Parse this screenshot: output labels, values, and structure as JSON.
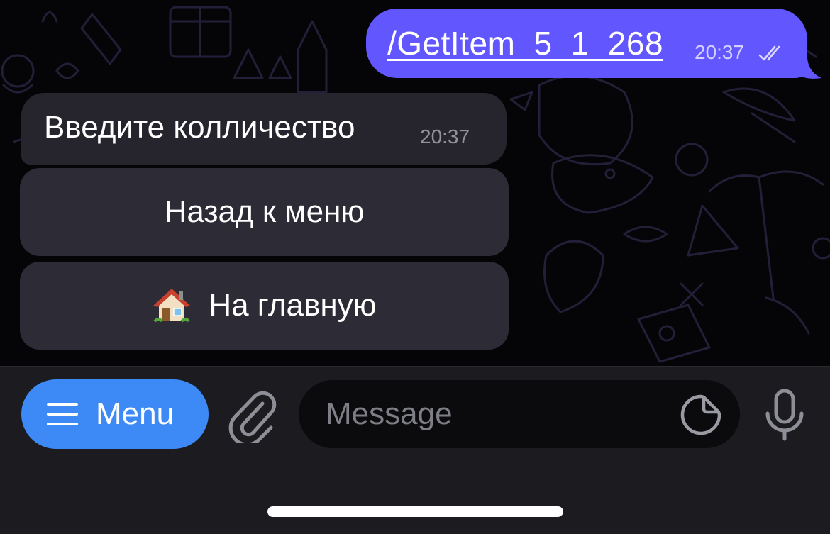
{
  "chat": {
    "outgoing": {
      "text": "/GetItem_5_1_268",
      "time": "20:37",
      "status_icon": "double-check-icon"
    },
    "incoming": {
      "text": "Введите колличество",
      "time": "20:37"
    },
    "keyboard": {
      "back_label": "Назад к меню",
      "home_label": "На главную",
      "home_icon": "house-icon"
    }
  },
  "input_bar": {
    "menu_label": "Menu",
    "message_placeholder": "Message",
    "icons": [
      "hamburger-icon",
      "paperclip-icon",
      "sticker-icon",
      "microphone-icon"
    ]
  },
  "colors": {
    "outgoing_bubble": "#6256ff",
    "incoming_bubble": "#26252e",
    "keyboard_button": "#2c2b36",
    "menu_button": "#3d8af7",
    "input_bar": "#1b1b20"
  }
}
